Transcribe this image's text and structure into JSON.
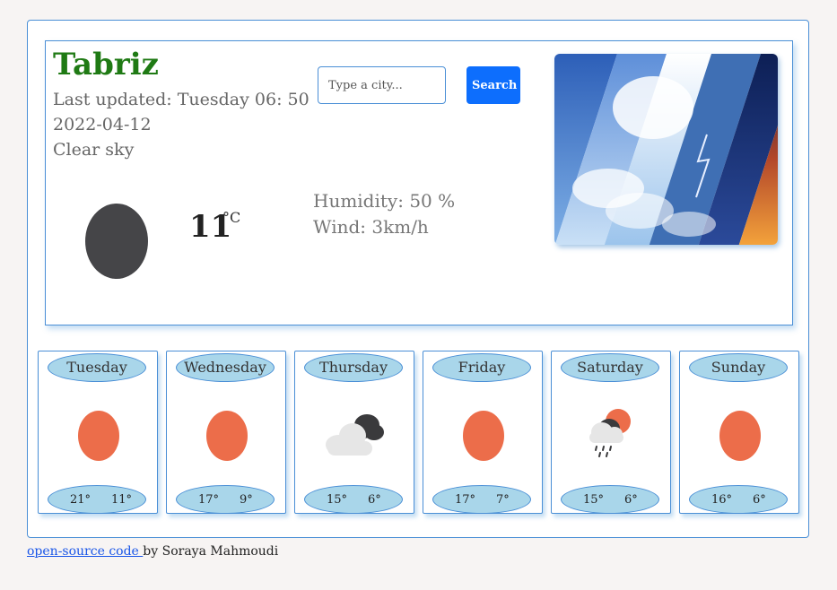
{
  "current": {
    "city": "Tabriz",
    "last_updated": "Last updated: Tuesday 06: 50",
    "date": "2022-04-12",
    "description": "Clear sky",
    "temperature": "11",
    "unit": "°C",
    "humidity": "Humidity: 50 %",
    "wind": "Wind: 3km/h"
  },
  "search": {
    "placeholder": "Type a city...",
    "button_label": "Search"
  },
  "forecast": [
    {
      "day": "Tuesday",
      "max": "21°",
      "min": "11°",
      "icon": "sun-icon"
    },
    {
      "day": "Wednesday",
      "max": "17°",
      "min": "9°",
      "icon": "sun-icon"
    },
    {
      "day": "Thursday",
      "max": "15°",
      "min": "6°",
      "icon": "cloud-icon"
    },
    {
      "day": "Friday",
      "max": "17°",
      "min": "7°",
      "icon": "sun-icon"
    },
    {
      "day": "Saturday",
      "max": "15°",
      "min": "6°",
      "icon": "sun-rain-icon"
    },
    {
      "day": "Sunday",
      "max": "16°",
      "min": "6°",
      "icon": "sun-icon"
    }
  ],
  "footer": {
    "link_text": "open-source code ",
    "author_text": "by Soraya Mahmoudi"
  },
  "colors": {
    "city": "#1f7a14",
    "accent": "#0d6efd",
    "pill": "#a9d6ea",
    "sun": "#ec6d4a",
    "border": "#4a8fd6"
  }
}
